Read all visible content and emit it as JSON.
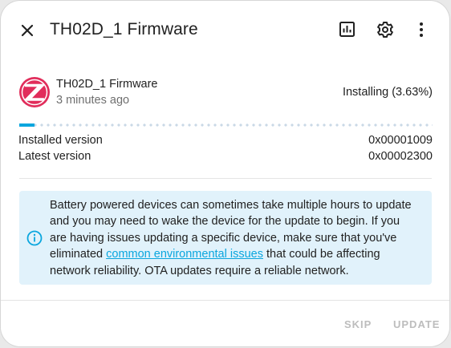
{
  "dialog": {
    "title": "TH02D_1 Firmware",
    "icons": [
      "close-icon",
      "chart-box-icon",
      "cog-icon",
      "dots-vertical-icon"
    ]
  },
  "entity": {
    "name": "TH02D_1 Firmware",
    "last_changed": "3 minutes ago",
    "status": "Installing (3.63%)",
    "progress_percent": 3.63,
    "logo": "zigbee-logo"
  },
  "versions": {
    "installed_label": "Installed version",
    "installed_value": "0x00001009",
    "latest_label": "Latest version",
    "latest_value": "0x00002300"
  },
  "alert": {
    "icon": "information-outline-icon",
    "text_before": "Battery powered devices can sometimes take multiple hours to update and you may need to wake the device for the update to begin. If you are having issues updating a specific device, make sure that you've eliminated ",
    "link_text": "common environmental issues",
    "text_after": " that could be affecting network reliability. OTA updates require a reliable network."
  },
  "actions": {
    "skip_label": "SKIP",
    "update_label": "UPDATE"
  },
  "colors": {
    "accent": "#0aa6de",
    "alert_bg": "#e1f2fb",
    "logo": "#e12d5b",
    "disabled_text": "#bdbdbd"
  }
}
